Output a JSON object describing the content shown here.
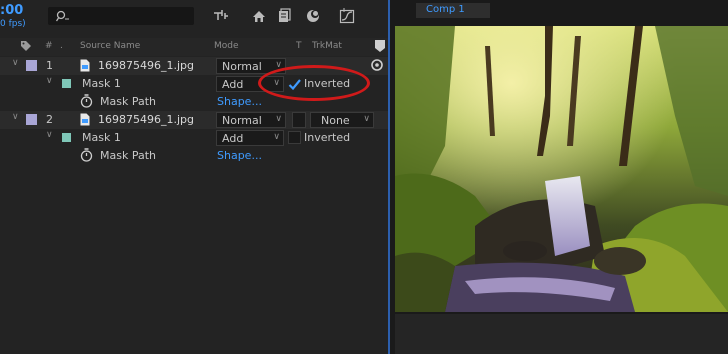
{
  "timeline": {
    "timecode": ":00",
    "fps": "0 fps)",
    "columns": {
      "num": "#",
      "source_name": "Source Name",
      "mode": "Mode",
      "t": "T",
      "trkmat": "TrkMat"
    },
    "layers": [
      {
        "number": "1",
        "name": "169875496_1.jpg",
        "mode": "Normal",
        "trkmat": "",
        "mask": {
          "name": "Mask 1",
          "mode": "Add",
          "inverted_label": "Inverted",
          "inverted": true,
          "path_label": "Mask Path",
          "path_value": "Shape..."
        }
      },
      {
        "number": "2",
        "name": "169875496_1.jpg",
        "mode": "Normal",
        "trkmat": "None",
        "mask": {
          "name": "Mask 1",
          "mode": "Add",
          "inverted_label": "Inverted",
          "inverted": false,
          "path_label": "Mask Path",
          "path_value": "Shape..."
        }
      }
    ]
  },
  "composition": {
    "tab_label": "Comp 1"
  },
  "colors": {
    "accent": "#3f9bff",
    "annotation": "#d01a1a",
    "label_swatch": "#a9a6d6",
    "mask_swatch": "#7fc7b8"
  },
  "icons": [
    "search-icon",
    "shy-icon",
    "frame-blend-icon",
    "motion-blur-icon",
    "graph-editor-icon",
    "comp-flowchart-icon",
    "stopwatch-icon",
    "footage-icon"
  ]
}
